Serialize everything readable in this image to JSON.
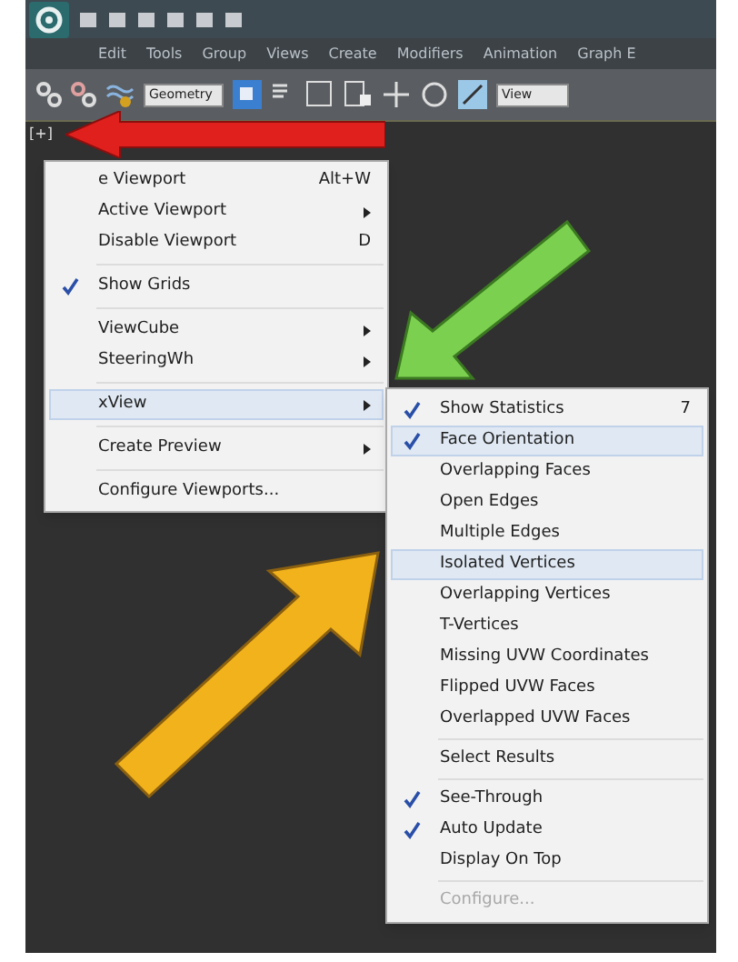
{
  "menu_bar": [
    "Edit",
    "Tools",
    "Group",
    "Views",
    "Create",
    "Modifiers",
    "Animation",
    "Graph E"
  ],
  "toolbar": {
    "selection_filter": "Geometry",
    "reference_coord": "View"
  },
  "viewport_label": "[+]",
  "viewport_menu": [
    {
      "kind": "item",
      "label": "e Viewport",
      "shortcut": "Alt+W",
      "checked": false,
      "submenu": false,
      "selected": false
    },
    {
      "kind": "item",
      "label": "Active Viewport",
      "checked": false,
      "submenu": true,
      "selected": false
    },
    {
      "kind": "item",
      "label": "Disable Viewport",
      "shortcut": "D",
      "checked": false,
      "submenu": false,
      "selected": false
    },
    {
      "kind": "separator"
    },
    {
      "kind": "item",
      "label": "Show Grids",
      "checked": true,
      "submenu": false,
      "selected": false
    },
    {
      "kind": "separator"
    },
    {
      "kind": "item",
      "label": "ViewCube",
      "checked": false,
      "submenu": true,
      "selected": false
    },
    {
      "kind": "item",
      "label": "SteeringWh",
      "checked": false,
      "submenu": true,
      "selected": false
    },
    {
      "kind": "separator"
    },
    {
      "kind": "item",
      "label": "xView",
      "checked": false,
      "submenu": true,
      "selected": true
    },
    {
      "kind": "separator"
    },
    {
      "kind": "item",
      "label": "Create Preview",
      "checked": false,
      "submenu": true,
      "selected": false
    },
    {
      "kind": "separator"
    },
    {
      "kind": "item",
      "label": "Configure Viewports...",
      "checked": false,
      "submenu": false,
      "selected": false
    }
  ],
  "xview_submenu": [
    {
      "kind": "item",
      "label": "Show Statistics",
      "shortcut": "7",
      "checked": true,
      "selected": false,
      "disabled": false
    },
    {
      "kind": "item",
      "label": "Face Orientation",
      "checked": true,
      "selected": true,
      "disabled": false
    },
    {
      "kind": "item",
      "label": "Overlapping Faces",
      "checked": false,
      "selected": false,
      "disabled": false
    },
    {
      "kind": "item",
      "label": "Open Edges",
      "checked": false,
      "selected": false,
      "disabled": false
    },
    {
      "kind": "item",
      "label": "Multiple Edges",
      "checked": false,
      "selected": false,
      "disabled": false
    },
    {
      "kind": "item",
      "label": "Isolated Vertices",
      "checked": false,
      "selected": true,
      "disabled": false
    },
    {
      "kind": "item",
      "label": "Overlapping Vertices",
      "checked": false,
      "selected": false,
      "disabled": false
    },
    {
      "kind": "item",
      "label": "T-Vertices",
      "checked": false,
      "selected": false,
      "disabled": false
    },
    {
      "kind": "item",
      "label": "Missing UVW Coordinates",
      "checked": false,
      "selected": false,
      "disabled": false
    },
    {
      "kind": "item",
      "label": "Flipped UVW Faces",
      "checked": false,
      "selected": false,
      "disabled": false
    },
    {
      "kind": "item",
      "label": "Overlapped UVW Faces",
      "checked": false,
      "selected": false,
      "disabled": false
    },
    {
      "kind": "separator"
    },
    {
      "kind": "item",
      "label": "Select Results",
      "checked": false,
      "selected": false,
      "disabled": false
    },
    {
      "kind": "separator"
    },
    {
      "kind": "item",
      "label": "See-Through",
      "checked": true,
      "selected": false,
      "disabled": false
    },
    {
      "kind": "item",
      "label": "Auto Update",
      "checked": true,
      "selected": false,
      "disabled": false
    },
    {
      "kind": "item",
      "label": "Display On Top",
      "checked": false,
      "selected": false,
      "disabled": false
    },
    {
      "kind": "separator"
    },
    {
      "kind": "item",
      "label": "Configure...",
      "checked": false,
      "selected": false,
      "disabled": true
    }
  ]
}
